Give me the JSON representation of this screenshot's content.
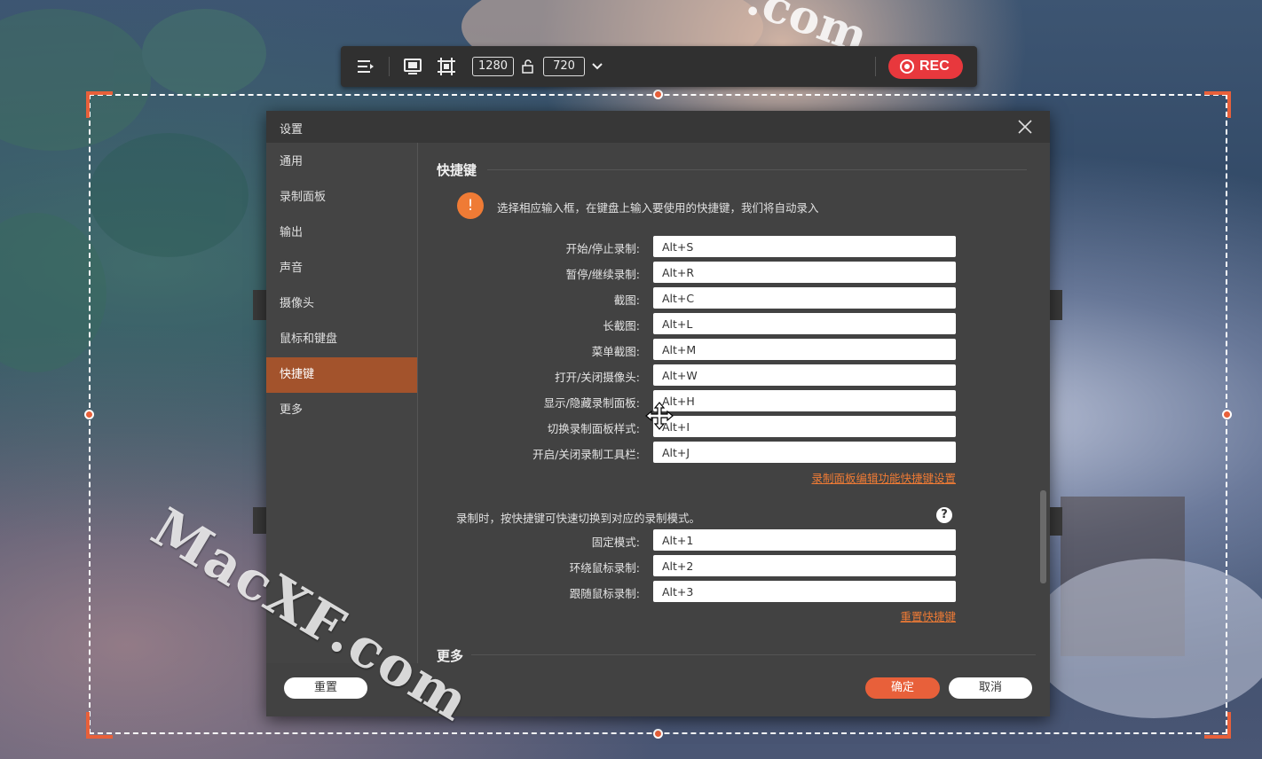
{
  "toolbar": {
    "width_value": "1280",
    "height_value": "720",
    "rec_label": "REC",
    "accent": "#e8383d"
  },
  "dialog": {
    "title": "设置",
    "sidebar": {
      "items": [
        {
          "label": "通用"
        },
        {
          "label": "录制面板"
        },
        {
          "label": "输出"
        },
        {
          "label": "声音"
        },
        {
          "label": "摄像头"
        },
        {
          "label": "鼠标和键盘"
        },
        {
          "label": "快捷键",
          "active": true
        },
        {
          "label": "更多"
        }
      ]
    },
    "section_title": "快捷键",
    "info_note": "选择相应输入框，在键盘上输入要使用的快捷键，我们将自动录入",
    "hotkeys": [
      {
        "label": "开始/停止录制:",
        "value": "Alt+S"
      },
      {
        "label": "暂停/继续录制:",
        "value": "Alt+R"
      },
      {
        "label": "截图:",
        "value": "Alt+C"
      },
      {
        "label": "长截图:",
        "value": "Alt+L"
      },
      {
        "label": "菜单截图:",
        "value": "Alt+M"
      },
      {
        "label": "打开/关闭摄像头:",
        "value": "Alt+W"
      },
      {
        "label": "显示/隐藏录制面板:",
        "value": "Alt+H"
      },
      {
        "label": "切换录制面板样式:",
        "value": "Alt+I"
      },
      {
        "label": "开启/关闭录制工具栏:",
        "value": "Alt+J"
      }
    ],
    "panel_edit_link": "录制面板编辑功能快捷键设置",
    "mode_note": "录制时，按快捷键可快速切换到对应的录制模式。",
    "help_symbol": "?",
    "mode_hotkeys": [
      {
        "label": "固定模式:",
        "value": "Alt+1"
      },
      {
        "label": "环绕鼠标录制:",
        "value": "Alt+2"
      },
      {
        "label": "跟随鼠标录制:",
        "value": "Alt+3"
      }
    ],
    "reset_hotkeys_link": "重置快捷键",
    "more_section_title": "更多",
    "footer": {
      "reset_label": "重置",
      "ok_label": "确定",
      "cancel_label": "取消"
    },
    "active_color": "#a3532c",
    "link_color": "#ef7b35"
  },
  "watermark": {
    "main": "MacXF.com",
    "top": ".com"
  }
}
